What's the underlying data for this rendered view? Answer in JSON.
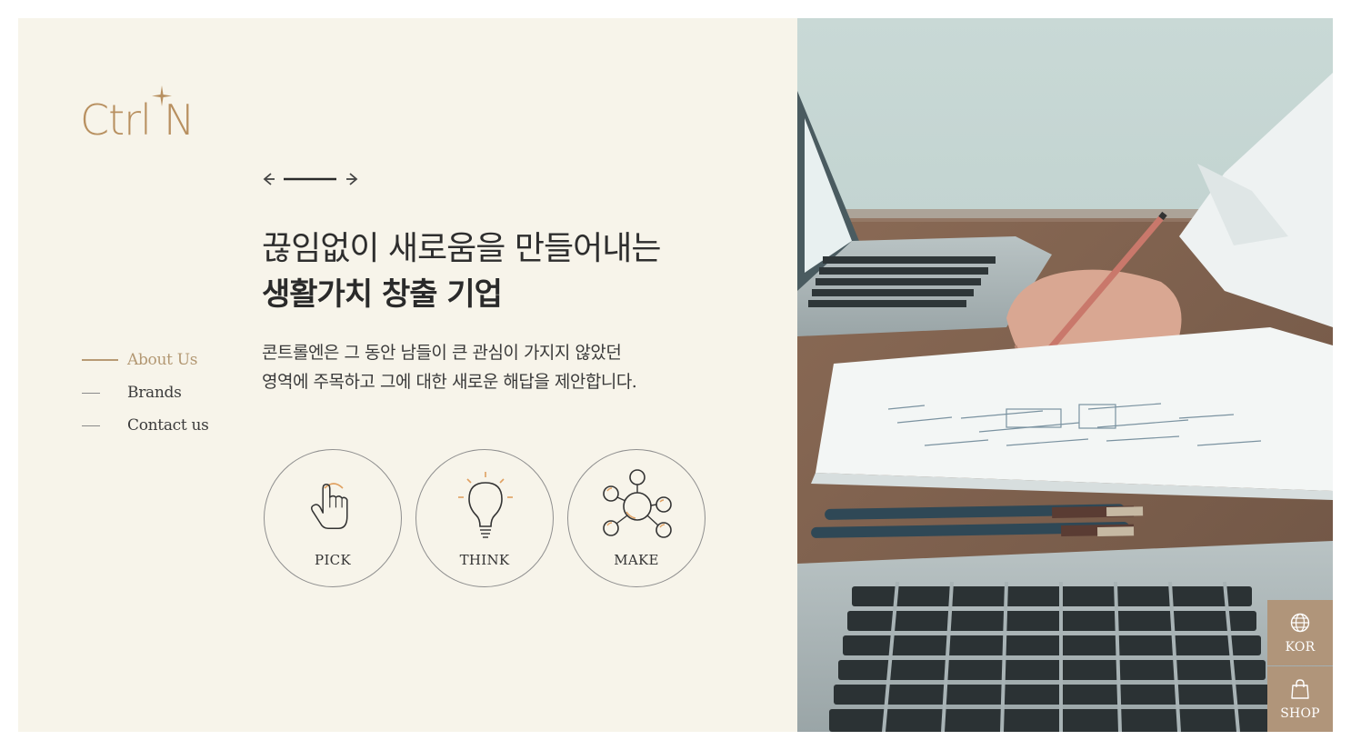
{
  "brand": {
    "logo_text": "CtrlN",
    "accent_color": "#b89a74"
  },
  "slider": {
    "prev_icon": "arrow-left-icon",
    "next_icon": "arrow-right-icon"
  },
  "hero": {
    "headline_line1": "끊임없이 새로움을 만들어내는",
    "headline_line2": "생활가치 창출 기업",
    "description_line1": "콘트롤엔은 그 동안 남들이 큰 관심이 가지지 않았던",
    "description_line2": "영역에 주목하고 그에 대한 새로운 해답을 제안합니다."
  },
  "side_nav": {
    "items": [
      {
        "label": "About Us",
        "active": true
      },
      {
        "label": "Brands",
        "active": false
      },
      {
        "label": "Contact us",
        "active": false
      }
    ]
  },
  "values": [
    {
      "label": "PICK",
      "icon": "pointing-hand-icon"
    },
    {
      "label": "THINK",
      "icon": "lightbulb-icon"
    },
    {
      "label": "MAKE",
      "icon": "network-icon"
    }
  ],
  "utility": {
    "language_label": "KOR",
    "language_icon": "globe-icon",
    "shop_label": "SHOP",
    "shop_icon": "shopping-bag-icon"
  },
  "colors": {
    "panel_bg": "#f7f4ea",
    "accent": "#b89a74",
    "util_bg": "#b0957a",
    "icon_accent": "#e0a060"
  }
}
